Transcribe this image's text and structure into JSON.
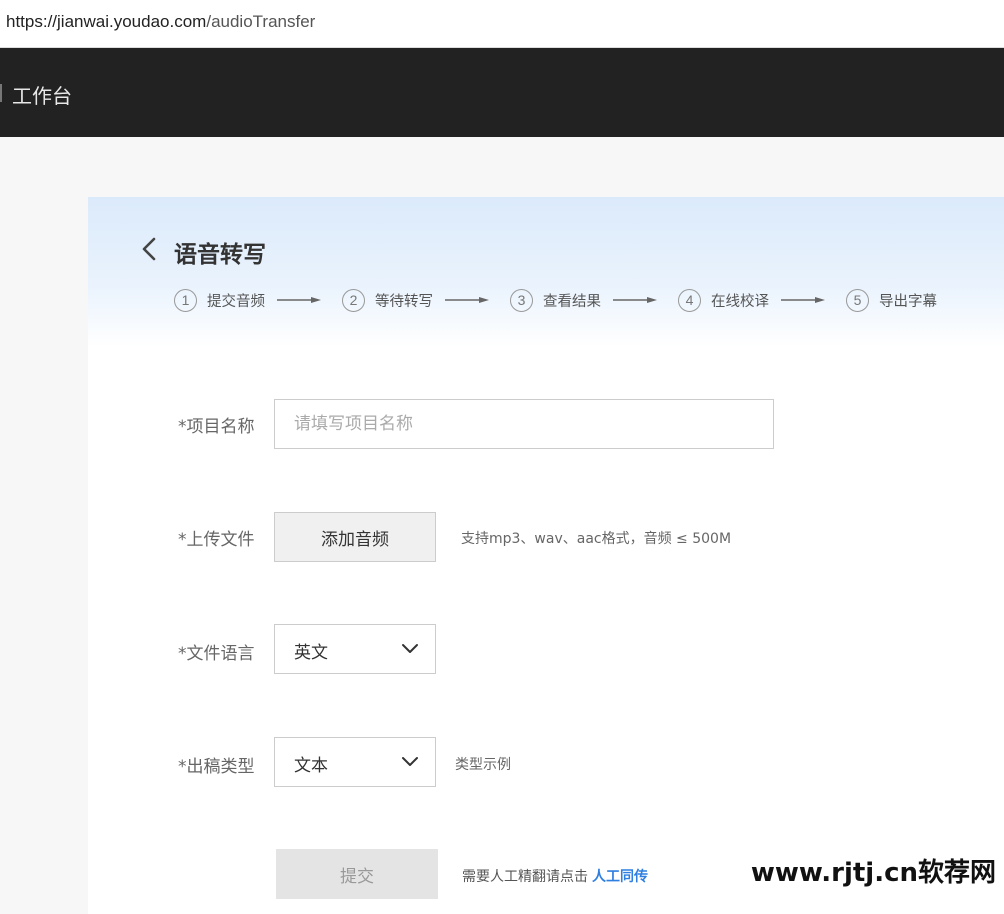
{
  "browser": {
    "url_domain": "https://jianwai.youdao.com",
    "url_path": "/audioTransfer"
  },
  "topnav": {
    "title": "工作台"
  },
  "page": {
    "title": "语音转写"
  },
  "steps": [
    {
      "num": "1",
      "label": "提交音频"
    },
    {
      "num": "2",
      "label": "等待转写"
    },
    {
      "num": "3",
      "label": "查看结果"
    },
    {
      "num": "4",
      "label": "在线校译"
    },
    {
      "num": "5",
      "label": "导出字幕"
    }
  ],
  "form": {
    "project_name": {
      "label": "*项目名称",
      "placeholder": "请填写项目名称",
      "value": ""
    },
    "upload": {
      "label": "*上传文件",
      "button": "添加音频",
      "hint": "支持mp3、wav、aac格式，音频 ≤ 500M"
    },
    "language": {
      "label": "*文件语言",
      "selected": "英文"
    },
    "output_type": {
      "label": "*出稿类型",
      "selected": "文本",
      "example_link": "类型示例"
    },
    "submit": {
      "label": "提交",
      "manual_text": "需要人工精翻请点击",
      "manual_link": "人工同传"
    }
  },
  "watermark": "www.rjtj.cn软荐网",
  "icons": {
    "back": "chevron-left-icon",
    "select": "chevron-down-icon",
    "step_arrow": "arrow-right-icon"
  },
  "colors": {
    "nav_bg": "#222222",
    "link": "#2f7fe0",
    "hero": "#dbeafb"
  }
}
